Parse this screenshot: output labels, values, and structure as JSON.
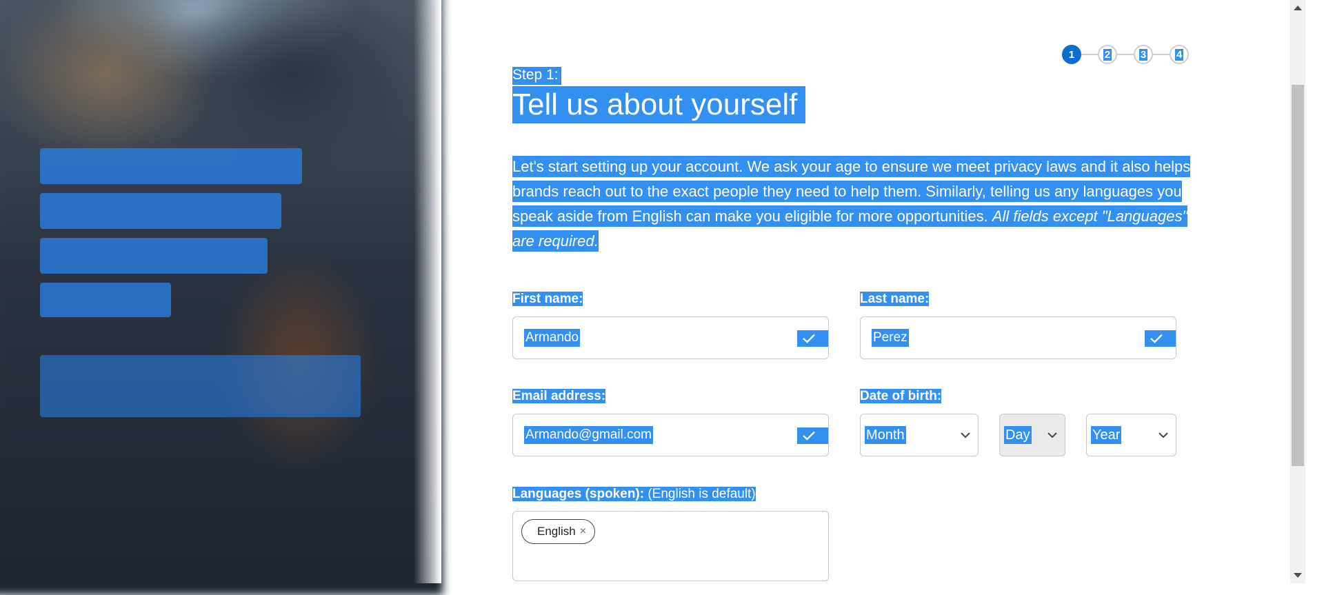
{
  "stepper": {
    "steps": [
      "1",
      "2",
      "3",
      "4"
    ],
    "active_step": 1
  },
  "header": {
    "step_label": "Step 1:",
    "title": "Tell us about yourself"
  },
  "intro": {
    "text": "Let's start setting up your account. We ask your age to ensure we meet privacy laws and it also helps brands reach out to the exact people they need to help them. Similarly, telling us any languages you speak aside from English can make you eligible for more opportunities. ",
    "required_note": "All fields except \"Languages\" are required."
  },
  "form": {
    "first_name": {
      "label": "First name:",
      "value": "Armando"
    },
    "last_name": {
      "label": "Last name:",
      "value": "Perez"
    },
    "email": {
      "label": "Email address:",
      "value": "Armando@gmail.com"
    },
    "dob": {
      "label": "Date of birth:",
      "month_value": "Month",
      "day_value": "Day",
      "year_value": "Year"
    },
    "languages": {
      "label": "Languages (spoken):",
      "hint": "(English is default)",
      "chips": [
        "English"
      ],
      "chip_remove": "×"
    }
  },
  "icons": {
    "check": "check-icon",
    "chevron": "chevron-down-icon",
    "remove": "close-icon"
  },
  "colors": {
    "accent": "#0a6fd1",
    "selection": "#3390f1",
    "border": "#c5cbd1"
  }
}
